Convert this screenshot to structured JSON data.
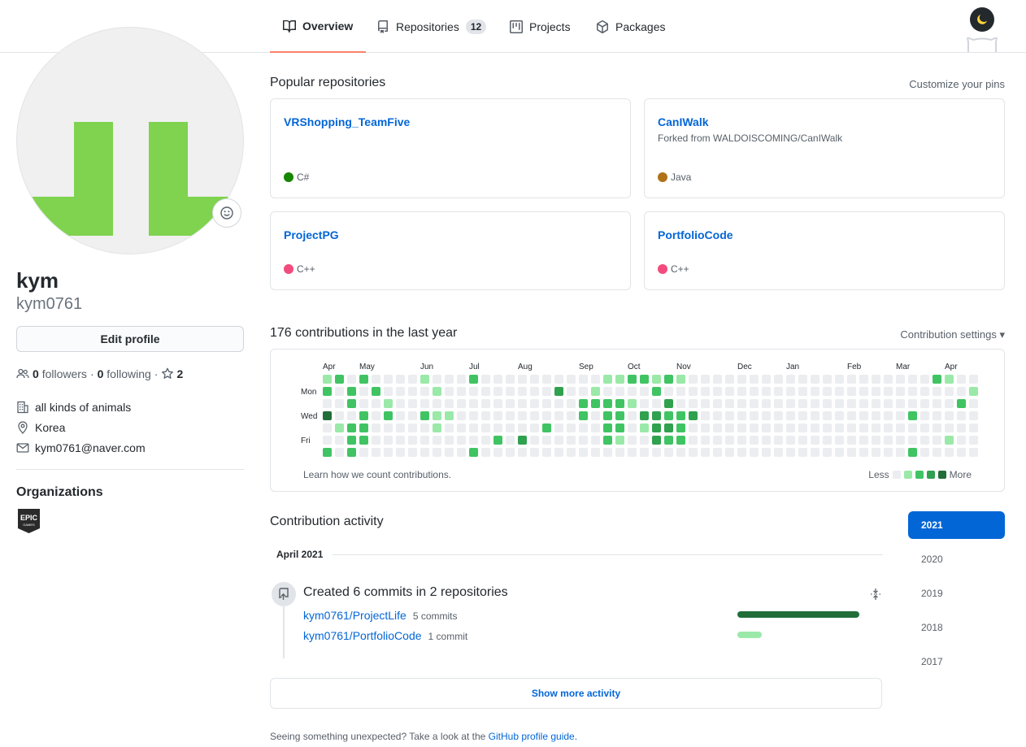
{
  "tabs": [
    {
      "label": "Overview",
      "icon": "book-icon"
    },
    {
      "label": "Repositories",
      "icon": "repo-icon",
      "count": "12"
    },
    {
      "label": "Projects",
      "icon": "project-icon"
    },
    {
      "label": "Packages",
      "icon": "package-icon"
    }
  ],
  "profile": {
    "name": "kym",
    "login": "kym0761",
    "edit_label": "Edit profile",
    "followers_count": "0",
    "followers_label": "followers",
    "following_count": "0",
    "following_label": "following",
    "stars_count": "2",
    "company": "all kinds of animals",
    "location": "Korea",
    "email": "kym0761@naver.com",
    "organizations_title": "Organizations",
    "org_logo_text": "EPIC GAMES"
  },
  "pinned": {
    "title": "Popular repositories",
    "customize_label": "Customize your pins",
    "repos": [
      {
        "name": "VRShopping_TeamFive",
        "desc": "",
        "lang": "C#",
        "lang_color": "#178600"
      },
      {
        "name": "CanIWalk",
        "desc": "Forked from WALDOISCOMING/CanIWalk",
        "lang": "Java",
        "lang_color": "#b07219"
      },
      {
        "name": "ProjectPG",
        "desc": "",
        "lang": "C++",
        "lang_color": "#f34b7d"
      },
      {
        "name": "PortfolioCode",
        "desc": "",
        "lang": "C++",
        "lang_color": "#f34b7d"
      }
    ]
  },
  "contributions": {
    "title": "176 contributions in the last year",
    "settings_label": "Contribution settings ▾",
    "months": [
      "Apr",
      "May",
      "Jun",
      "Jul",
      "Aug",
      "Sep",
      "Oct",
      "Nov",
      "Dec",
      "Jan",
      "Feb",
      "Mar",
      "Apr"
    ],
    "month_weeks": [
      0,
      3,
      8,
      12,
      16,
      21,
      25,
      29,
      34,
      38,
      43,
      47,
      51
    ],
    "days": [
      "Mon",
      "Wed",
      "Fri"
    ],
    "learn_label": "Learn how we count contributions.",
    "less_label": "Less",
    "more_label": "More",
    "colors": [
      "#ebedf0",
      "#9be9a8",
      "#40c463",
      "#30a14e",
      "#216e39"
    ],
    "weeks": [
      [
        1,
        2,
        0,
        4,
        0,
        0,
        2
      ],
      [
        2,
        0,
        0,
        0,
        1,
        0,
        0
      ],
      [
        0,
        2,
        2,
        0,
        2,
        2,
        2
      ],
      [
        2,
        0,
        0,
        2,
        2,
        2,
        0
      ],
      [
        0,
        2,
        0,
        0,
        0,
        0,
        0
      ],
      [
        0,
        0,
        1,
        2,
        0,
        0,
        0
      ],
      [
        0,
        0,
        0,
        0,
        0,
        0,
        0
      ],
      [
        0,
        0,
        0,
        0,
        0,
        0,
        0
      ],
      [
        1,
        0,
        0,
        2,
        0,
        0,
        0
      ],
      [
        0,
        1,
        0,
        1,
        1,
        0,
        0
      ],
      [
        0,
        0,
        0,
        1,
        0,
        0,
        0
      ],
      [
        0,
        0,
        0,
        0,
        0,
        0,
        0
      ],
      [
        2,
        0,
        0,
        0,
        0,
        0,
        2
      ],
      [
        0,
        0,
        0,
        0,
        0,
        0,
        0
      ],
      [
        0,
        0,
        0,
        0,
        0,
        2,
        0
      ],
      [
        0,
        0,
        0,
        0,
        0,
        0,
        0
      ],
      [
        0,
        0,
        0,
        0,
        0,
        3,
        0
      ],
      [
        0,
        0,
        0,
        0,
        0,
        0,
        0
      ],
      [
        0,
        0,
        0,
        0,
        2,
        0,
        0
      ],
      [
        0,
        3,
        0,
        0,
        0,
        0,
        0
      ],
      [
        0,
        0,
        0,
        0,
        0,
        0,
        0
      ],
      [
        0,
        0,
        2,
        2,
        0,
        0,
        0
      ],
      [
        0,
        1,
        2,
        0,
        0,
        0,
        0
      ],
      [
        1,
        0,
        2,
        2,
        2,
        2,
        0
      ],
      [
        1,
        0,
        2,
        2,
        2,
        1,
        0
      ],
      [
        2,
        0,
        1,
        0,
        0,
        0,
        0
      ],
      [
        2,
        0,
        0,
        3,
        1,
        0,
        0
      ],
      [
        1,
        2,
        0,
        3,
        3,
        3,
        0
      ],
      [
        2,
        0,
        3,
        2,
        3,
        2,
        0
      ],
      [
        1,
        0,
        0,
        2,
        2,
        2,
        0
      ],
      [
        0,
        0,
        0,
        3,
        0,
        0,
        0
      ],
      [
        0,
        0,
        0,
        0,
        0,
        0,
        0
      ],
      [
        0,
        0,
        0,
        0,
        0,
        0,
        0
      ],
      [
        0,
        0,
        0,
        0,
        0,
        0,
        0
      ],
      [
        0,
        0,
        0,
        0,
        0,
        0,
        0
      ],
      [
        0,
        0,
        0,
        0,
        0,
        0,
        0
      ],
      [
        0,
        0,
        0,
        0,
        0,
        0,
        0
      ],
      [
        0,
        0,
        0,
        0,
        0,
        0,
        0
      ],
      [
        0,
        0,
        0,
        0,
        0,
        0,
        0
      ],
      [
        0,
        0,
        0,
        0,
        0,
        0,
        0
      ],
      [
        0,
        0,
        0,
        0,
        0,
        0,
        0
      ],
      [
        0,
        0,
        0,
        0,
        0,
        0,
        0
      ],
      [
        0,
        0,
        0,
        0,
        0,
        0,
        0
      ],
      [
        0,
        0,
        0,
        0,
        0,
        0,
        0
      ],
      [
        0,
        0,
        0,
        0,
        0,
        0,
        0
      ],
      [
        0,
        0,
        0,
        0,
        0,
        0,
        0
      ],
      [
        0,
        0,
        0,
        0,
        0,
        0,
        0
      ],
      [
        0,
        0,
        0,
        0,
        0,
        0,
        0
      ],
      [
        0,
        0,
        0,
        2,
        0,
        0,
        2
      ],
      [
        0,
        0,
        0,
        0,
        0,
        0,
        0
      ],
      [
        2,
        0,
        0,
        0,
        0,
        0,
        0
      ],
      [
        1,
        0,
        0,
        0,
        0,
        1,
        0
      ],
      [
        0,
        0,
        2,
        0,
        0,
        0,
        0
      ],
      [
        0,
        1,
        0,
        0,
        0,
        0,
        0
      ]
    ]
  },
  "activity": {
    "title": "Contribution activity",
    "month_label": "April 2021",
    "event_title": "Created 6 commits in 2 repositories",
    "repos": [
      {
        "name": "kym0761/ProjectLife",
        "count_label": "5 commits",
        "commits": 5,
        "color": "#216e39"
      },
      {
        "name": "kym0761/PortfolioCode",
        "count_label": "1 commit",
        "commits": 1,
        "color": "#9be9a8"
      }
    ],
    "show_more_label": "Show more activity",
    "footer_text": "Seeing something unexpected? Take a look at the",
    "footer_link": "GitHub profile guide."
  },
  "years": [
    "2021",
    "2020",
    "2019",
    "2018",
    "2017"
  ],
  "selected_year": "2021"
}
